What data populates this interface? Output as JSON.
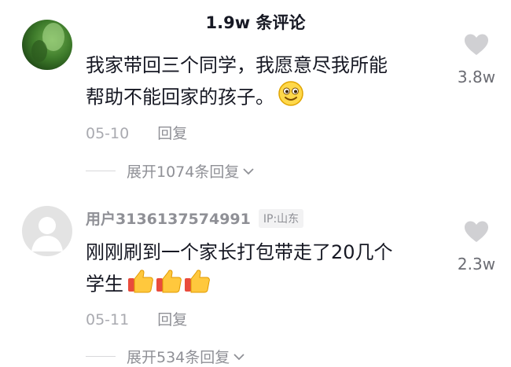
{
  "header": {
    "title": "1.9w 条评论"
  },
  "comments": [
    {
      "text_line1": "我家带回三个同学，我愿意尽我所能",
      "text_line2": "帮助不能回家的孩子。",
      "emoji": "smile-emoji",
      "date": "05-10",
      "reply_label": "回复",
      "like_count": "3.8w",
      "expand_label": "展开1074条回复"
    },
    {
      "username": "用户3136137574991",
      "ip_label": "IP:山东",
      "text_line1": "刚刚刷到一个家长打包带走了20几个",
      "text_line2": "学生",
      "emoji": "thumbs-up-emoji",
      "date": "05-11",
      "reply_label": "回复",
      "like_count": "2.3w",
      "expand_label": "展开534条回复"
    }
  ],
  "colors": {
    "text_primary": "#161823",
    "text_secondary": "#8f9096",
    "like_icon": "#d0d0d3"
  }
}
